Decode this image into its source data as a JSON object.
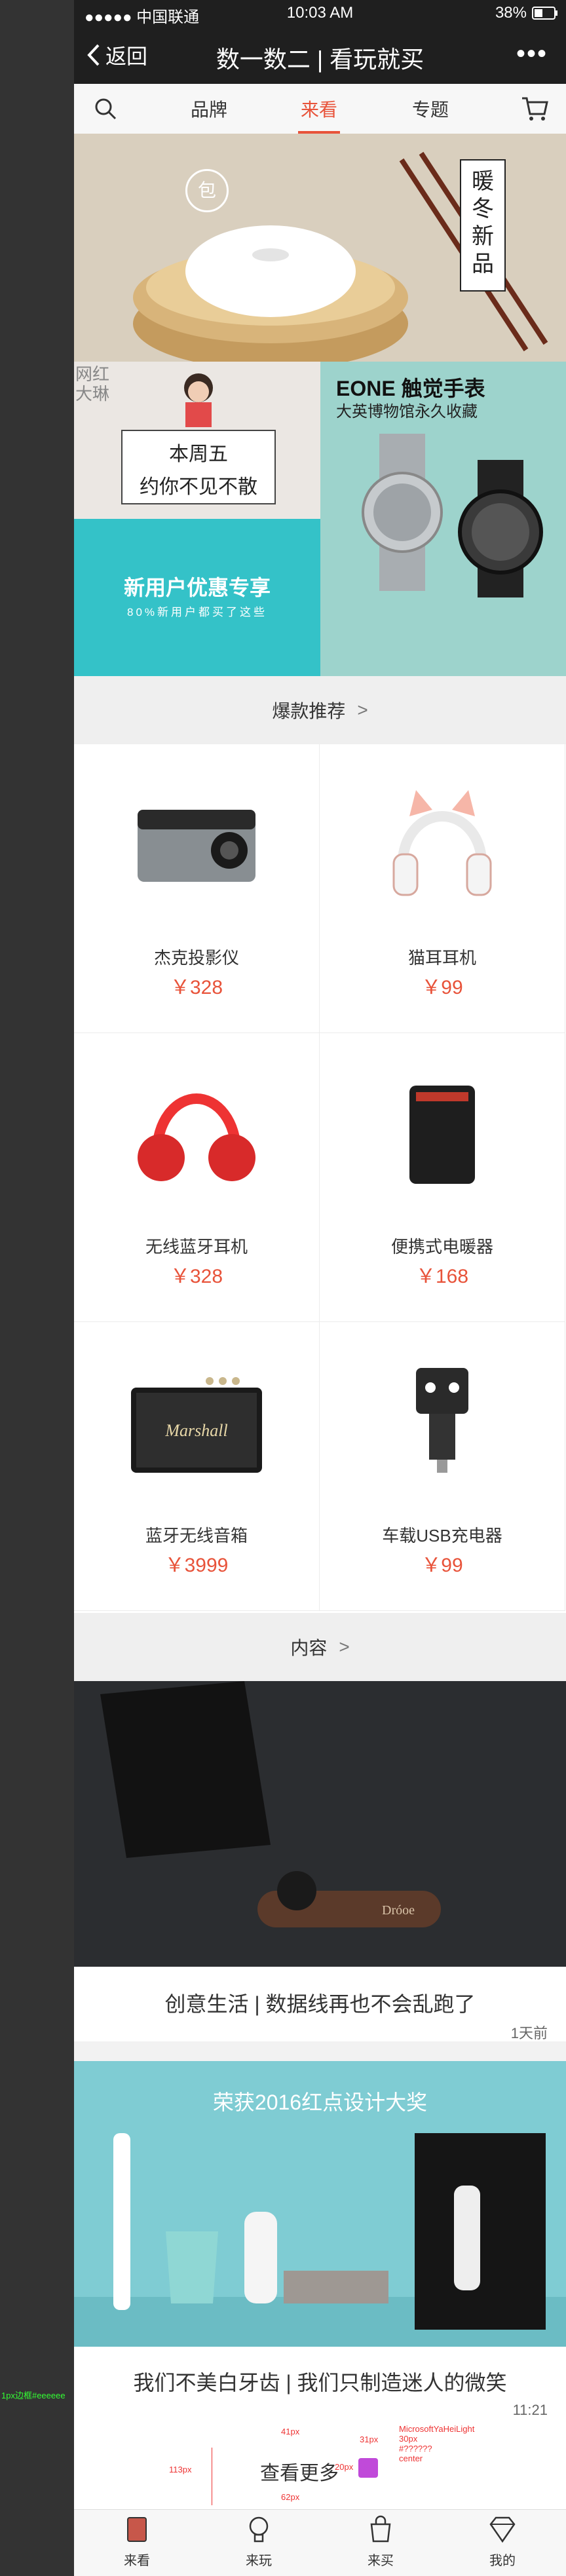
{
  "status": {
    "carrier": "●●●●● 中国联通",
    "time": "10:03 AM",
    "battery": "38%"
  },
  "nav": {
    "back": "返回",
    "title": "数一数二 | 看玩就买",
    "more": "•••"
  },
  "tabs": [
    "品牌",
    "来看",
    "专题"
  ],
  "hero": {
    "badge": "包",
    "tagline": [
      "暖",
      "冬",
      "新",
      "品"
    ]
  },
  "banner_left": {
    "stamp": [
      "网红",
      "大琳"
    ],
    "sign_line1": "本周五",
    "sign_line2": "约你不见不散",
    "promo_title": "新用户优惠专享",
    "promo_sub": "80%新用户都买了这些"
  },
  "banner_right": {
    "title": "EONE 触觉手表",
    "subtitle": "大英博物馆永久收藏"
  },
  "section_hot": {
    "label": "爆款推荐"
  },
  "products": [
    {
      "name": "杰克投影仪",
      "price": "￥328",
      "icon": "projector-icon"
    },
    {
      "name": "猫耳耳机",
      "price": "￥99",
      "icon": "cat-ear-headphones-icon"
    },
    {
      "name": "无线蓝牙耳机",
      "price": "￥328",
      "icon": "red-headphones-icon"
    },
    {
      "name": "便携式电暖器",
      "price": "￥168",
      "icon": "heater-icon"
    },
    {
      "name": "蓝牙无线音箱",
      "price": "￥3999",
      "icon": "speaker-icon"
    },
    {
      "name": "车载USB充电器",
      "price": "￥99",
      "icon": "car-charger-icon"
    }
  ],
  "section_content": {
    "label": "内容"
  },
  "articles": [
    {
      "title": "创意生活 | 数据线再也不会乱跑了",
      "time": "1天前",
      "brand": "Dróoe"
    },
    {
      "title": "我们不美白牙齿 | 我们只制造迷人的微笑",
      "time": "11:21",
      "caption": "荣获2016红点设计大奖"
    }
  ],
  "load_more": {
    "label": "查看更多",
    "annot_font": "MicrosoftYaHeiLight",
    "annot_size": "30px",
    "annot_color": "#??????",
    "annot_align": "center",
    "annot_a": "41px",
    "annot_b": "113px",
    "annot_c": "62px",
    "annot_d": "31px",
    "annot_e": "20px"
  },
  "side_note": "1px边框#eeeeee",
  "bottom_tabs": [
    {
      "label": "来看",
      "icon": "book-icon"
    },
    {
      "label": "来玩",
      "icon": "lightbulb-icon"
    },
    {
      "label": "来买",
      "icon": "shopping-bag-icon"
    },
    {
      "label": "我的",
      "icon": "diamond-icon"
    }
  ],
  "colors": {
    "accent": "#e8533a",
    "nav_bg": "#1f1f1f",
    "teal": "#9dd3cc"
  }
}
